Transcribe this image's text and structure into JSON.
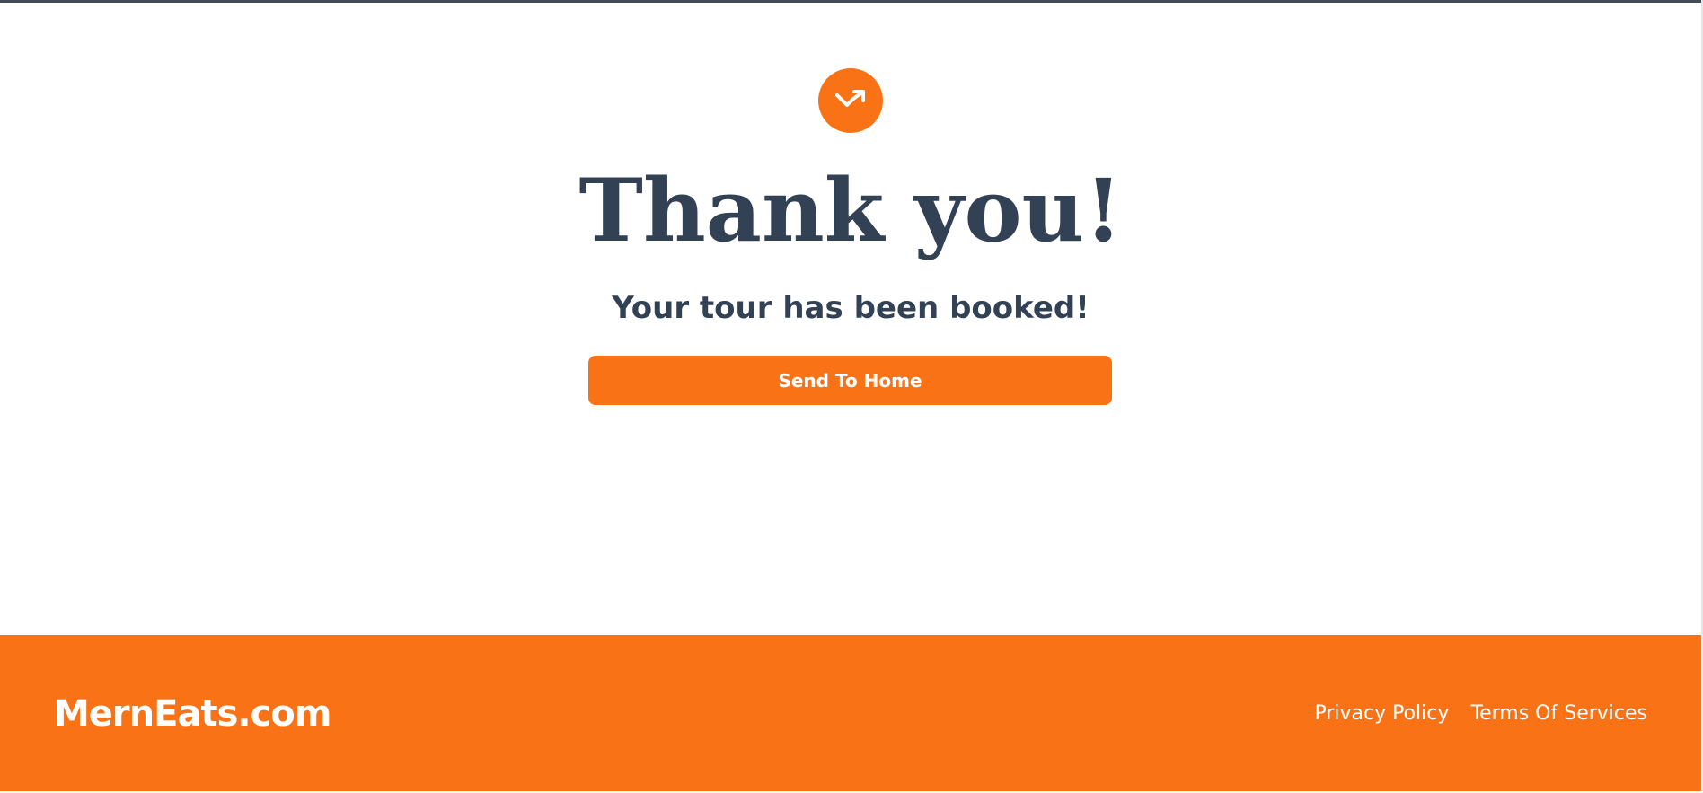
{
  "confirmation": {
    "icon": "arrow-trend-icon",
    "title": "Thank you!",
    "message": "Your tour has been booked!",
    "button_label": "Send To Home"
  },
  "footer": {
    "brand": "MernEats.com",
    "links": [
      {
        "label": "Privacy Policy"
      },
      {
        "label": "Terms Of Services"
      }
    ]
  },
  "colors": {
    "accent": "#f97316",
    "text_dark": "#334155",
    "background": "#ffffff"
  }
}
